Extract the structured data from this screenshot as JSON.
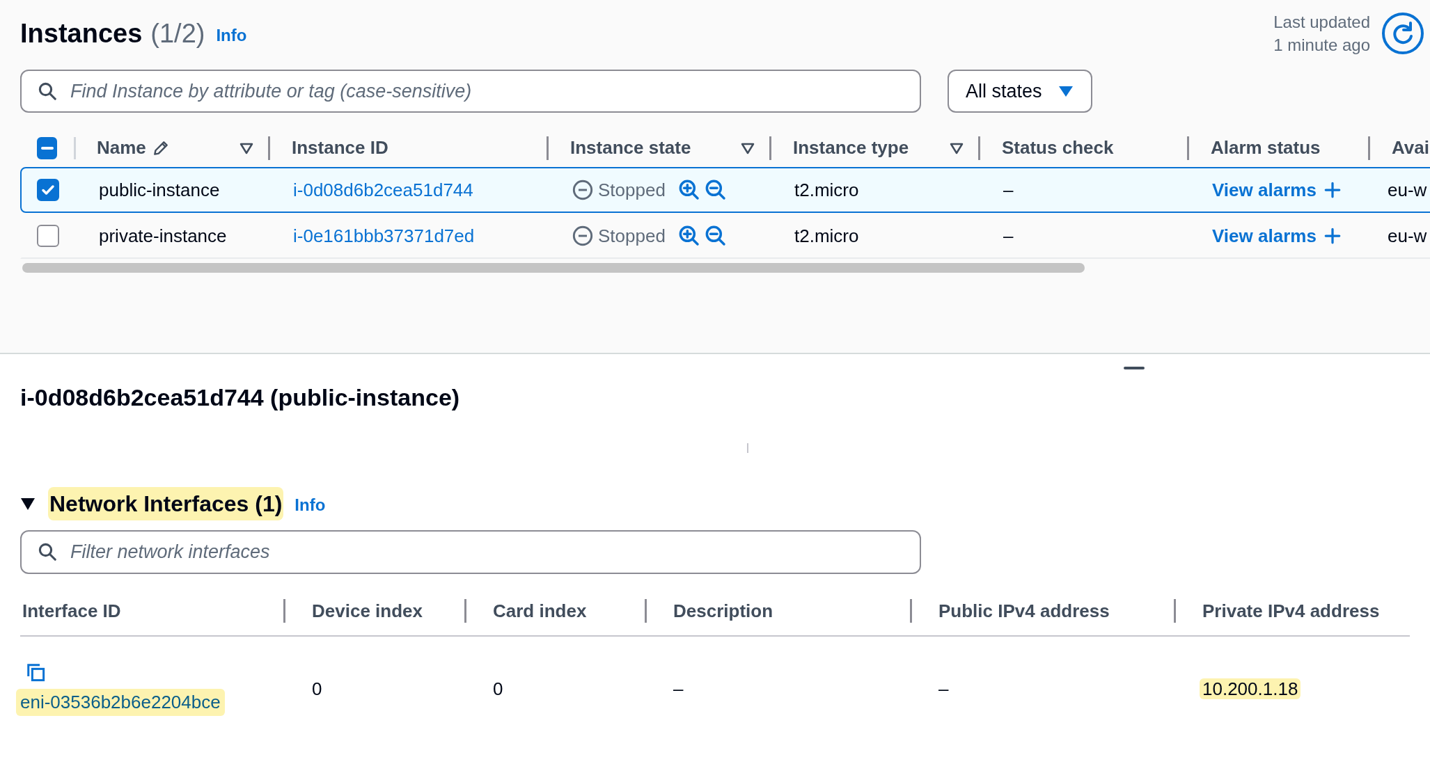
{
  "instances": {
    "title": "Instances",
    "count": "(1/2)",
    "info": "Info",
    "last_updated": [
      "Last updated",
      "1 minute ago"
    ],
    "search": {
      "placeholder": "Find Instance by attribute or tag (case-sensitive)"
    },
    "state_filter": "All states",
    "select_all": {
      "indeterminate": true
    },
    "columns": [
      {
        "label": "Name",
        "editable": true,
        "filterable": true
      },
      {
        "label": "Instance ID",
        "editable": false,
        "filterable": false
      },
      {
        "label": "Instance state",
        "editable": false,
        "filterable": true
      },
      {
        "label": "Instance type",
        "editable": false,
        "filterable": true
      },
      {
        "label": "Status check",
        "editable": false,
        "filterable": false
      },
      {
        "label": "Alarm status",
        "editable": false,
        "filterable": false
      },
      {
        "label": "Avai"
      }
    ],
    "rows": [
      {
        "selected": true,
        "name": "public-instance",
        "instance_id": "i-0d08d6b2cea51d744",
        "state": "Stopped",
        "type": "t2.micro",
        "status_check": "–",
        "alarm_status": "View alarms",
        "zone": "eu-w"
      },
      {
        "selected": false,
        "name": "private-instance",
        "instance_id": "i-0e161bbb37371d7ed",
        "state": "Stopped",
        "type": "t2.micro",
        "status_check": "–",
        "alarm_status": "View alarms",
        "zone": "eu-w"
      }
    ]
  },
  "details": {
    "title": "i-0d08d6b2cea51d744 (public-instance)"
  },
  "network_interfaces": {
    "expanded": true,
    "title": "Network Interfaces (1)",
    "title_highlighted": true,
    "info": "Info",
    "filter": {
      "placeholder": "Filter network interfaces"
    },
    "columns": [
      "Interface ID",
      "Device index",
      "Card index",
      "Description",
      "Public IPv4 address",
      "Private IPv4 address"
    ],
    "rows": [
      {
        "cells": [
          {
            "kind": "link",
            "text": "eni-03536b2b6e2204bce",
            "highlighted": true
          },
          {
            "kind": "text",
            "text": "0",
            "highlighted": false
          },
          {
            "kind": "text",
            "text": "0",
            "highlighted": false
          },
          {
            "kind": "text",
            "text": "–",
            "highlighted": false
          },
          {
            "kind": "text",
            "text": "–",
            "highlighted": false
          },
          {
            "kind": "text",
            "text": "10.200.1.18",
            "highlighted": true
          }
        ]
      }
    ]
  }
}
